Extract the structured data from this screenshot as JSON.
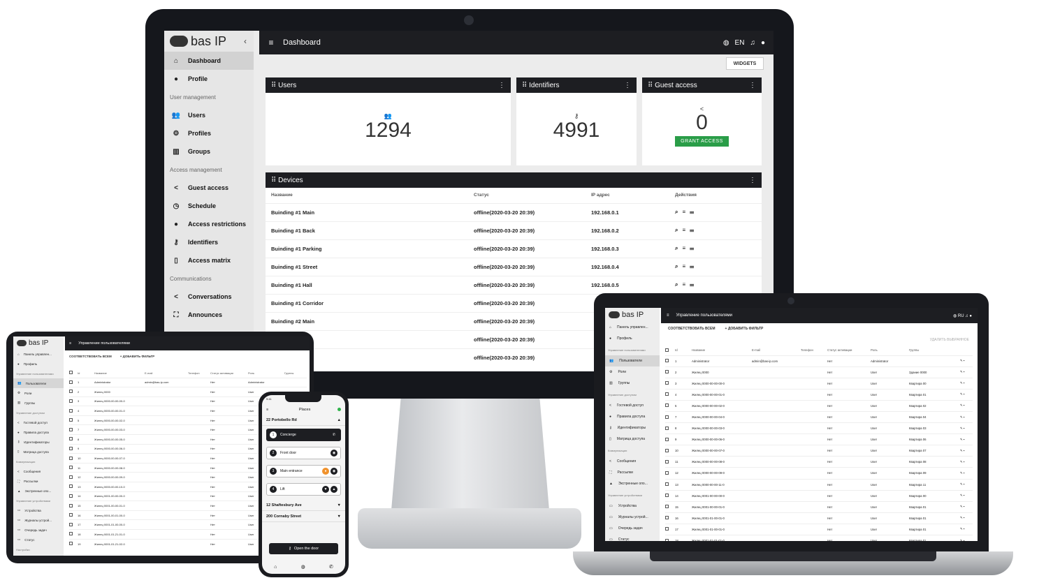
{
  "brand": {
    "logo_text": "bas IP"
  },
  "monitor": {
    "sidebar": {
      "items": [
        {
          "type": "item",
          "label": "Dashboard",
          "icon": "home-icon",
          "glyph": "⌂",
          "active": true
        },
        {
          "type": "item",
          "label": "Profile",
          "icon": "person-icon",
          "glyph": "●"
        },
        {
          "type": "header",
          "label": "User management"
        },
        {
          "type": "item",
          "label": "Users",
          "icon": "people-icon",
          "glyph": "👥"
        },
        {
          "type": "item",
          "label": "Profiles",
          "icon": "profile-settings-icon",
          "glyph": "⚙"
        },
        {
          "type": "item",
          "label": "Groups",
          "icon": "bar-chart-icon",
          "glyph": "▥"
        },
        {
          "type": "header",
          "label": "Access management"
        },
        {
          "type": "item",
          "label": "Guest access",
          "icon": "share-icon",
          "glyph": "<"
        },
        {
          "type": "item",
          "label": "Schedule",
          "icon": "clock-icon",
          "glyph": "◷"
        },
        {
          "type": "item",
          "label": "Access restrictions",
          "icon": "alert-icon",
          "glyph": "●"
        },
        {
          "type": "item",
          "label": "Identifiers",
          "icon": "key-icon",
          "glyph": "⚷"
        },
        {
          "type": "item",
          "label": "Access matrix",
          "icon": "map-icon",
          "glyph": "▯"
        },
        {
          "type": "header",
          "label": "Communications"
        },
        {
          "type": "item",
          "label": "Conversations",
          "icon": "share-icon",
          "glyph": "<"
        },
        {
          "type": "item",
          "label": "Announces",
          "icon": "fullscreen-icon",
          "glyph": "⛶"
        }
      ]
    },
    "topbar": {
      "title": "Dashboard",
      "lang": "EN"
    },
    "widgets_button": "WIDGETS",
    "cards": [
      {
        "title": "Users",
        "value": "1294",
        "icon": "people-icon",
        "glyph": "👥"
      },
      {
        "title": "Identifiers",
        "value": "4991",
        "icon": "key-icon",
        "glyph": "⚷"
      },
      {
        "title": "Guest access",
        "value": "0",
        "icon": "share-icon",
        "glyph": "<",
        "button": "GRANT ACCESS"
      }
    ],
    "devices": {
      "title": "Devices",
      "columns": [
        "Название",
        "Статус",
        "IP адрес",
        "Действия"
      ],
      "rows": [
        {
          "name": "Buinding #1 Main",
          "status": "offline(2020-03-20 20:39)",
          "ip": "192.168.0.1"
        },
        {
          "name": "Buinding #1 Back",
          "status": "offline(2020-03-20 20:39)",
          "ip": "192.168.0.2"
        },
        {
          "name": "Buinding #1 Parking",
          "status": "offline(2020-03-20 20:39)",
          "ip": "192.168.0.3"
        },
        {
          "name": "Buinding #1 Street",
          "status": "offline(2020-03-20 20:39)",
          "ip": "192.168.0.4"
        },
        {
          "name": "Buinding #1 Hall",
          "status": "offline(2020-03-20 20:39)",
          "ip": "192.168.0.5"
        },
        {
          "name": "Buinding #1 Corridor",
          "status": "offline(2020-03-20 20:39)",
          "ip": ""
        },
        {
          "name": "Buinding #2 Main",
          "status": "offline(2020-03-20 20:39)",
          "ip": ""
        },
        {
          "name": "",
          "status": "offline(2020-03-20 20:39)",
          "ip": ""
        },
        {
          "name": "",
          "status": "offline(2020-03-20 20:39)",
          "ip": ""
        }
      ]
    }
  },
  "tablet": {
    "topbar_title": "Управление пользователями",
    "filters": [
      "СООТВЕТСТВОВАТЬ ВСЕМ",
      "+ ДОБАВИТЬ ФИЛЬТР"
    ],
    "sidebar": [
      {
        "type": "item",
        "label": "Панель управлен...",
        "glyph": "⌂"
      },
      {
        "type": "item",
        "label": "Профиль",
        "glyph": "●"
      },
      {
        "type": "header",
        "label": "Управление пользователями"
      },
      {
        "type": "item",
        "label": "Пользователи",
        "glyph": "👥",
        "active": true
      },
      {
        "type": "item",
        "label": "Роли",
        "glyph": "⚙"
      },
      {
        "type": "item",
        "label": "Группы",
        "glyph": "▥"
      },
      {
        "type": "header",
        "label": "Управление доступом"
      },
      {
        "type": "item",
        "label": "Гостевой доступ",
        "glyph": "<"
      },
      {
        "type": "item",
        "label": "Правила доступа",
        "glyph": "●"
      },
      {
        "type": "item",
        "label": "Идентификаторы",
        "glyph": "⚷"
      },
      {
        "type": "item",
        "label": "Матрица доступа",
        "glyph": "▯"
      },
      {
        "type": "header",
        "label": "Коммуникации"
      },
      {
        "type": "item",
        "label": "Сообщения",
        "glyph": "<"
      },
      {
        "type": "item",
        "label": "Рассылки",
        "glyph": "⛶"
      },
      {
        "type": "item",
        "label": "Экстренные опо...",
        "glyph": "▲"
      },
      {
        "type": "header",
        "label": "Управление устройствами"
      },
      {
        "type": "item",
        "label": "Устройства",
        "glyph": "▭"
      },
      {
        "type": "item",
        "label": "Журналы устрой...",
        "glyph": "▭"
      },
      {
        "type": "item",
        "label": "Очередь задач",
        "glyph": "▭"
      },
      {
        "type": "item",
        "label": "Статус",
        "glyph": "▭"
      },
      {
        "type": "header",
        "label": "Настройки"
      }
    ],
    "columns": [
      "Id",
      "Название",
      "E-mail",
      "Телефон",
      "Статус активации",
      "Роль",
      "Группы"
    ],
    "rows": [
      {
        "id": "1",
        "name": "Administrator",
        "email": "admin@bas-ip.com",
        "status": "Нет",
        "role": "Administrator"
      },
      {
        "id": "2",
        "name": "Жилец 0000",
        "email": "",
        "status": "Нет",
        "role": "User"
      },
      {
        "id": "3",
        "name": "Жилец 0000-00-00-00-0",
        "email": "",
        "status": "Нет",
        "role": "User"
      },
      {
        "id": "4",
        "name": "Жилец 0000-00-00-01-0",
        "email": "",
        "status": "Нет",
        "role": "User"
      },
      {
        "id": "5",
        "name": "Жилец 0000-00-00-02-0",
        "email": "",
        "status": "Нет",
        "role": "User"
      },
      {
        "id": "7",
        "name": "Жилец 0000-00-00-03-0",
        "email": "",
        "status": "Нет",
        "role": "User"
      },
      {
        "id": "8",
        "name": "Жилец 0000-00-00-05-0",
        "email": "",
        "status": "Нет",
        "role": "User"
      },
      {
        "id": "9",
        "name": "Жилец 0000-00-00-06-0",
        "email": "",
        "status": "Нет",
        "role": "User"
      },
      {
        "id": "10",
        "name": "Жилец 0000-00-00-07-0",
        "email": "",
        "status": "Нет",
        "role": "User"
      },
      {
        "id": "11",
        "name": "Жилец 0000-00-00-08-0",
        "email": "",
        "status": "Нет",
        "role": "User"
      },
      {
        "id": "12",
        "name": "Жилец 0000-00-00-09-0",
        "email": "",
        "status": "Нет",
        "role": "User"
      },
      {
        "id": "13",
        "name": "Жилец 0000-00-00-10-0",
        "email": "",
        "status": "Нет",
        "role": "User"
      },
      {
        "id": "14",
        "name": "Жилец 0001-00-00-00-0",
        "email": "",
        "status": "Нет",
        "role": "User"
      },
      {
        "id": "15",
        "name": "Жилец 0001-00-00-01-0",
        "email": "",
        "status": "Нет",
        "role": "User"
      },
      {
        "id": "16",
        "name": "Жилец 0001-00-01-00-0",
        "email": "",
        "status": "Нет",
        "role": "User"
      },
      {
        "id": "17",
        "name": "Жилец 0001-01-00-00-0",
        "email": "",
        "status": "Нет",
        "role": "User"
      },
      {
        "id": "18",
        "name": "Жилец 0001-01-21-01-0",
        "email": "",
        "status": "Нет",
        "role": "User"
      },
      {
        "id": "19",
        "name": "Жилец 0001-01-21-02-0",
        "email": "",
        "status": "Нет",
        "role": "User"
      }
    ]
  },
  "laptop": {
    "topbar_title": "Управление пользователями",
    "filters": [
      "СООТВЕТСТВОВАТЬ ВСЕМ",
      "+ ДОБАВИТЬ ФИЛЬТР"
    ],
    "delete_label": "УДАЛИТЬ ВЫБРАННОЕ",
    "sidebar": [
      {
        "type": "item",
        "label": "Панель управлен...",
        "glyph": "⌂"
      },
      {
        "type": "item",
        "label": "Профиль",
        "glyph": "●"
      },
      {
        "type": "header",
        "label": "Управление пользователями"
      },
      {
        "type": "item",
        "label": "Пользователи",
        "glyph": "👥",
        "active": true
      },
      {
        "type": "item",
        "label": "Роли",
        "glyph": "⚙"
      },
      {
        "type": "item",
        "label": "Группы",
        "glyph": "▥"
      },
      {
        "type": "header",
        "label": "Управление доступом"
      },
      {
        "type": "item",
        "label": "Гостевой доступ",
        "glyph": "<"
      },
      {
        "type": "item",
        "label": "Правила доступа",
        "glyph": "●"
      },
      {
        "type": "item",
        "label": "Идентификаторы",
        "glyph": "⚷"
      },
      {
        "type": "item",
        "label": "Матрица доступа",
        "glyph": "▯"
      },
      {
        "type": "header",
        "label": "Коммуникации"
      },
      {
        "type": "item",
        "label": "Сообщения",
        "glyph": "<"
      },
      {
        "type": "item",
        "label": "Рассылки",
        "glyph": "⛶"
      },
      {
        "type": "item",
        "label": "Экстренные опо...",
        "glyph": "▲"
      },
      {
        "type": "header",
        "label": "Управление устройствами"
      },
      {
        "type": "item",
        "label": "Устройства",
        "glyph": "▭"
      },
      {
        "type": "item",
        "label": "Журналы устрой...",
        "glyph": "▭"
      },
      {
        "type": "item",
        "label": "Очередь задач",
        "glyph": "▭"
      },
      {
        "type": "item",
        "label": "Статус",
        "glyph": "▭"
      }
    ],
    "columns": [
      "Id",
      "Название",
      "E-mail",
      "Телефон",
      "Статус активации",
      "Роль",
      "Группы"
    ],
    "rows": [
      {
        "id": "1",
        "name": "Administrator",
        "email": "admin@bas-ip.com",
        "status": "Нет",
        "role": "Administrator",
        "group": ""
      },
      {
        "id": "2",
        "name": "Жилец 0000",
        "email": "",
        "status": "Нет",
        "role": "User",
        "group": "Здание 0000"
      },
      {
        "id": "3",
        "name": "Жилец 0000-00-00-00-0",
        "email": "",
        "status": "Нет",
        "role": "User",
        "group": "Квартира 00"
      },
      {
        "id": "4",
        "name": "Жилец 0000-00-00-01-0",
        "email": "",
        "status": "Нет",
        "role": "User",
        "group": "Квартира 01"
      },
      {
        "id": "5",
        "name": "Жилец 0000-00-00-02-0",
        "email": "",
        "status": "Нет",
        "role": "User",
        "group": "Квартира 02"
      },
      {
        "id": "7",
        "name": "Жилец 0000-00-00-04-0",
        "email": "",
        "status": "Нет",
        "role": "User",
        "group": "Квартира 04"
      },
      {
        "id": "8",
        "name": "Жилец 0000-00-00-03-0",
        "email": "",
        "status": "Нет",
        "role": "User",
        "group": "Квартира 03"
      },
      {
        "id": "9",
        "name": "Жилец 0000-00-00-06-0",
        "email": "",
        "status": "Нет",
        "role": "User",
        "group": "Квартира 06"
      },
      {
        "id": "10",
        "name": "Жилец 0000-00-00-07-0",
        "email": "",
        "status": "Нет",
        "role": "User",
        "group": "Квартира 07"
      },
      {
        "id": "11",
        "name": "Жилец 0000-00-00-08-0",
        "email": "",
        "status": "Нет",
        "role": "User",
        "group": "Квартира 08"
      },
      {
        "id": "12",
        "name": "Жилец 0000-00-00-09-0",
        "email": "",
        "status": "Нет",
        "role": "User",
        "group": "Квартира 09"
      },
      {
        "id": "13",
        "name": "Жилец 0000-00-00-11-0",
        "email": "",
        "status": "Нет",
        "role": "User",
        "group": "Квартира 11"
      },
      {
        "id": "14",
        "name": "Жилец 0001-00-00-00-0",
        "email": "",
        "status": "Нет",
        "role": "User",
        "group": "Квартира 00"
      },
      {
        "id": "15",
        "name": "Жилец 0001-00-00-01-0",
        "email": "",
        "status": "Нет",
        "role": "User",
        "group": "Квартира 01"
      },
      {
        "id": "16",
        "name": "Жилец 0001-01-00-01-0",
        "email": "",
        "status": "Нет",
        "role": "User",
        "group": "Квартира 01"
      },
      {
        "id": "17",
        "name": "Жилец 0001-01-00-01-0",
        "email": "",
        "status": "Нет",
        "role": "User",
        "group": "Квартира 01"
      },
      {
        "id": "18",
        "name": "Жилец 0001-01-01-01-0",
        "email": "",
        "status": "Нет",
        "role": "User",
        "group": "Квартира 01"
      }
    ]
  },
  "phone": {
    "status_time": "9:41",
    "header_title": "Places",
    "locations": [
      {
        "label": "22 Portobello Rd",
        "chevron": "▲",
        "expanded": true
      },
      {
        "label": "12 Shaftesbury Ave",
        "chevron": "▼"
      },
      {
        "label": "200 Cornaby Street",
        "chevron": "▼"
      }
    ],
    "doors": [
      {
        "num": "1",
        "label": "Concierge",
        "dark": true,
        "buttons": [
          "✆"
        ]
      },
      {
        "num": "2",
        "label": "Front door",
        "buttons": [
          "◉"
        ]
      },
      {
        "num": "3",
        "label": "Main entrance",
        "buttons": [
          "●",
          "◉"
        ],
        "orange": true
      },
      {
        "num": "4",
        "label": "Lift",
        "buttons": [
          "▼",
          "▲"
        ]
      }
    ],
    "open_button": "Open the door",
    "tabbar": [
      "⌂",
      "◍",
      "✆"
    ]
  }
}
